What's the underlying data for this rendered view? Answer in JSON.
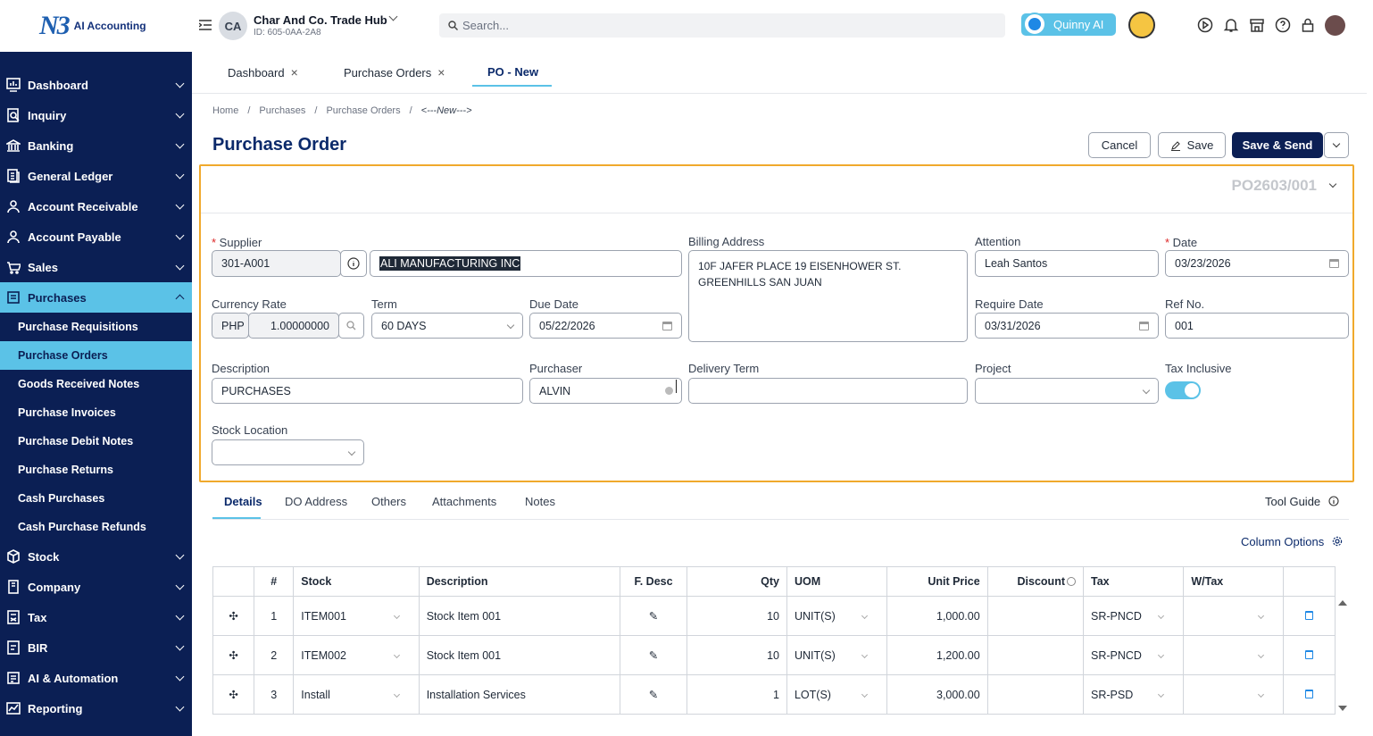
{
  "brand": {
    "logo_mark": "N3",
    "logo_text": "AI Accounting"
  },
  "sidebar": {
    "items": [
      {
        "label": "Dashboard",
        "icon": "dashboard-icon"
      },
      {
        "label": "Inquiry",
        "icon": "inquiry-icon"
      },
      {
        "label": "Banking",
        "icon": "bank-icon"
      },
      {
        "label": "General Ledger",
        "icon": "ledger-icon"
      },
      {
        "label": "Account Receivable",
        "icon": "receivable-icon"
      },
      {
        "label": "Account Payable",
        "icon": "payable-icon"
      },
      {
        "label": "Sales",
        "icon": "sales-icon"
      },
      {
        "label": "Purchases",
        "icon": "purchases-icon",
        "active": true
      }
    ],
    "purchases_sub": [
      "Purchase Requisitions",
      "Purchase Orders",
      "Goods Received Notes",
      "Purchase Invoices",
      "Purchase Debit Notes",
      "Purchase Returns",
      "Cash Purchases",
      "Cash Purchase Refunds"
    ],
    "items_after": [
      {
        "label": "Stock",
        "icon": "stock-icon"
      },
      {
        "label": "Company",
        "icon": "company-icon"
      },
      {
        "label": "Tax",
        "icon": "tax-icon"
      },
      {
        "label": "BIR",
        "icon": "bir-icon"
      },
      {
        "label": "AI & Automation",
        "icon": "ai-icon"
      },
      {
        "label": "Reporting",
        "icon": "reporting-icon"
      }
    ]
  },
  "topbar": {
    "avatar_initials": "CA",
    "company_name": "Char And Co. Trade Hub",
    "company_id": "ID: 605-0AA-2A8",
    "search_placeholder": "Search...",
    "quinny_label": "Quinny AI"
  },
  "page_tabs": [
    "Dashboard",
    "Purchase Orders",
    "PO - New"
  ],
  "breadcrumb": [
    "Home",
    "Purchases",
    "Purchase Orders",
    "<---New--->"
  ],
  "page_title": "Purchase Order",
  "actions": {
    "cancel": "Cancel",
    "save": "Save",
    "save_send": "Save & Send"
  },
  "form": {
    "po_number": "PO2603/001",
    "supplier_label": "Supplier",
    "supplier_code": "301-A001",
    "supplier_name": "ALI MANUFACTURING INC",
    "billing_label": "Billing Address",
    "billing_line1": "10F JAFER PLACE 19 EISENHOWER ST.",
    "billing_line2": "GREENHILLS SAN JUAN",
    "attention_label": "Attention",
    "attention": "Leah Santos",
    "date_label": "Date",
    "date": "03/23/2026",
    "currency_label": "Currency Rate",
    "currency": "PHP",
    "rate": "1.00000000",
    "term_label": "Term",
    "term": "60 DAYS",
    "due_label": "Due Date",
    "due_date": "05/22/2026",
    "require_label": "Require Date",
    "require_date": "03/31/2026",
    "ref_label": "Ref No.",
    "ref_no": "001",
    "description_label": "Description",
    "description": "PURCHASES",
    "purchaser_label": "Purchaser",
    "purchaser": "ALVIN",
    "delivery_label": "Delivery Term",
    "delivery_term": "",
    "project_label": "Project",
    "project": "",
    "tax_inclusive_label": "Tax Inclusive",
    "tax_inclusive": true,
    "stock_location_label": "Stock Location",
    "stock_location": ""
  },
  "detail_tabs": [
    "Details",
    "DO Address",
    "Others",
    "Attachments",
    "Notes"
  ],
  "tool_guide": "Tool Guide",
  "column_options": "Column Options",
  "table": {
    "headers": [
      "",
      "#",
      "Stock",
      "Description",
      "F. Desc",
      "Qty",
      "UOM",
      "Unit Price",
      "Discount",
      "Tax",
      "W/Tax",
      ""
    ],
    "rows": [
      {
        "no": "1",
        "stock": "ITEM001",
        "desc": "Stock Item 001",
        "qty": "10",
        "uom": "UNIT(S)",
        "price": "1,000.00",
        "discount": "",
        "tax": "SR-PNCD",
        "wtax": ""
      },
      {
        "no": "2",
        "stock": "ITEM002",
        "desc": "Stock Item 001",
        "qty": "10",
        "uom": "UNIT(S)",
        "price": "1,200.00",
        "discount": "",
        "tax": "SR-PNCD",
        "wtax": ""
      },
      {
        "no": "3",
        "stock": "Install",
        "desc": "Installation Services",
        "qty": "1",
        "uom": "LOT(S)",
        "price": "3,000.00",
        "discount": "",
        "tax": "SR-PSD",
        "wtax": ""
      }
    ]
  },
  "colors": {
    "sidebar_bg": "#0b1f54",
    "accent": "#5bc2e7",
    "highlight_border": "#f0a92c"
  }
}
